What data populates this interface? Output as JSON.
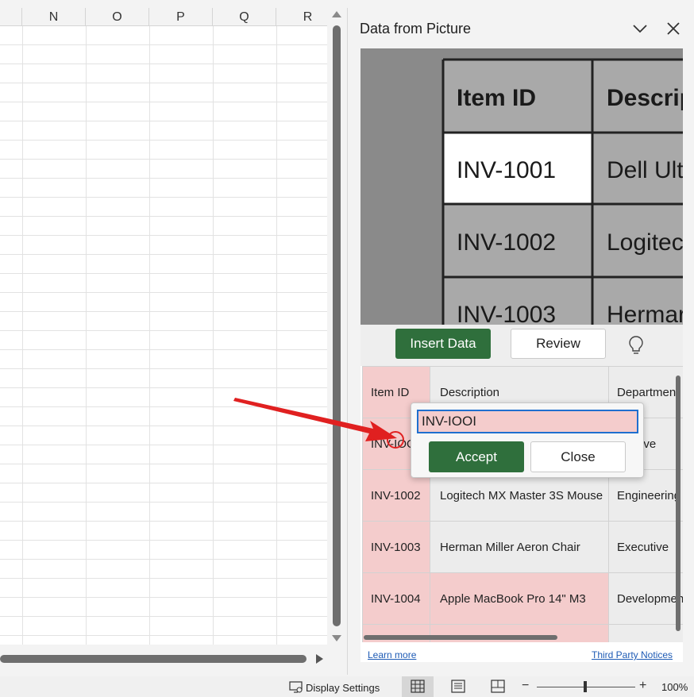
{
  "spreadsheet": {
    "columns": [
      "N",
      "O",
      "P",
      "Q",
      "R"
    ]
  },
  "pane": {
    "title": "Data from Picture",
    "picture": {
      "headers": [
        "Item ID",
        "Descrip"
      ],
      "rows": [
        [
          "INV-1001",
          "Dell Ult"
        ],
        [
          "INV-1002",
          "Logitec"
        ],
        [
          "INV-1003",
          "Hermar"
        ]
      ]
    },
    "insert_label": "Insert Data",
    "review_label": "Review",
    "table": {
      "header": [
        "Item ID",
        "Description",
        "Department"
      ],
      "rows": [
        [
          "INV-IOO",
          "",
          "ive"
        ],
        [
          "INV-1002",
          "Logitech MX Master 3S Mouse",
          "Engineering"
        ],
        [
          "INV-1003",
          "Herman Miller Aeron Chair",
          "Executive"
        ],
        [
          "INV-1004",
          "Apple MacBook Pro 14\" M3",
          "Developmen"
        ]
      ]
    },
    "popup": {
      "value": "INV-IOOI",
      "accept_label": "Accept",
      "close_label": "Close"
    },
    "footer": {
      "learn_more": "Learn more",
      "third_party": "Third Party Notices"
    }
  },
  "statusbar": {
    "display_settings": "Display Settings",
    "zoom": "100%",
    "zoom_level": 1.0
  },
  "colors": {
    "accent_green": "#2f6f3c",
    "error_fill": "#f4cccc",
    "focus_blue": "#1f6fcf",
    "annotation_red": "#e02020"
  }
}
